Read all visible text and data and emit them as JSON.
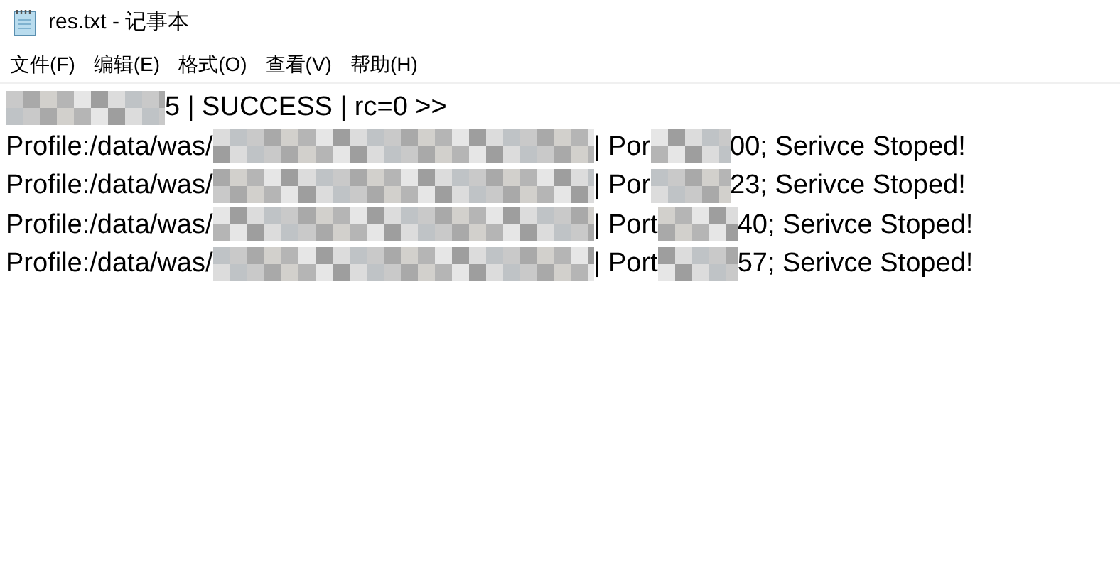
{
  "window": {
    "title": "res.txt - 记事本"
  },
  "menu": [
    "文件(F)",
    "编辑(E)",
    "格式(O)",
    "查看(V)",
    "帮助(H)"
  ],
  "lines": [
    {
      "parts": [
        {
          "kind": "mosaic"
        },
        {
          "kind": "text",
          "text": "5 | SUCCESS | rc=0 >>"
        }
      ]
    },
    {
      "parts": [
        {
          "kind": "text",
          "text": "Profile:/data/was/"
        },
        {
          "kind": "mosaic"
        },
        {
          "kind": "text",
          "text": "| Por"
        },
        {
          "kind": "mosaic"
        },
        {
          "kind": "text",
          "text": "00; Serivce Stoped!"
        }
      ]
    },
    {
      "parts": [
        {
          "kind": "text",
          "text": "Profile:/data/was/"
        },
        {
          "kind": "mosaic"
        },
        {
          "kind": "text",
          "text": "| Por"
        },
        {
          "kind": "mosaic"
        },
        {
          "kind": "text",
          "text": "23; Serivce Stoped!"
        }
      ]
    },
    {
      "parts": [
        {
          "kind": "text",
          "text": "Profile:/data/was/"
        },
        {
          "kind": "mosaic"
        },
        {
          "kind": "text",
          "text": "| Port"
        },
        {
          "kind": "mosaic"
        },
        {
          "kind": "text",
          "text": "40; Serivce Stoped!"
        }
      ]
    },
    {
      "parts": [
        {
          "kind": "text",
          "text": "Profile:/data/was/"
        },
        {
          "kind": "mosaic"
        },
        {
          "kind": "text",
          "text": "| Port"
        },
        {
          "kind": "mosaic"
        },
        {
          "kind": "text",
          "text": "57; Serivce Stoped!"
        }
      ]
    }
  ]
}
